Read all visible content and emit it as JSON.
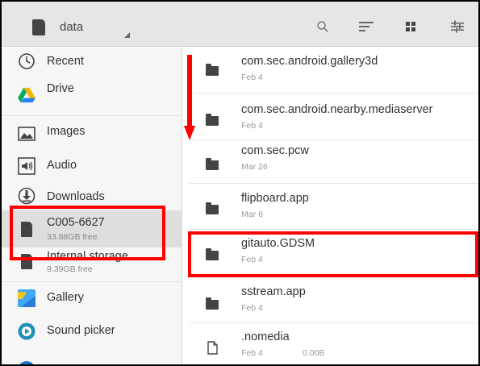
{
  "toolbar": {
    "title": "data",
    "buttons": [
      "search-icon",
      "sort-icon",
      "grid-view-icon",
      "settings-sliders-icon"
    ]
  },
  "sidebar": {
    "items": [
      {
        "label": "Recent",
        "icon": "clock-icon"
      },
      {
        "label": "Drive",
        "icon": "drive-icon"
      },
      {
        "label": "Images",
        "icon": "image-icon"
      },
      {
        "label": "Audio",
        "icon": "audio-icon"
      },
      {
        "label": "Downloads",
        "icon": "download-icon"
      },
      {
        "label": "C005-6627",
        "sub": "33.88GB free",
        "icon": "sd-card-icon"
      },
      {
        "label": "Internal storage",
        "sub": "9.39GB free",
        "icon": "sd-card-icon"
      },
      {
        "label": "Gallery",
        "icon": "gallery-icon"
      },
      {
        "label": "Sound picker",
        "icon": "sound-picker-icon"
      }
    ]
  },
  "files": [
    {
      "name": "com.sec.android.gallery3d",
      "date": "Feb 4",
      "type": "folder"
    },
    {
      "name": "com.sec.android.nearby.mediaserver",
      "date": "Feb 4",
      "type": "folder"
    },
    {
      "name": "com.sec.pcw",
      "date": "Mar 26",
      "type": "folder"
    },
    {
      "name": "flipboard.app",
      "date": "Mar 6",
      "type": "folder"
    },
    {
      "name": "gitauto.GDSM",
      "date": "Feb 4",
      "type": "folder"
    },
    {
      "name": "sstream.app",
      "date": "Feb 4",
      "type": "folder"
    },
    {
      "name": ".nomedia",
      "date": "Feb 4",
      "size": "0.00B",
      "type": "file"
    }
  ],
  "colors": {
    "toolbar_bg": "#e6e6e6",
    "sidebar_bg": "#f6f6f6",
    "selected_bg": "#dedede",
    "annotation_red": "#ff0000"
  }
}
